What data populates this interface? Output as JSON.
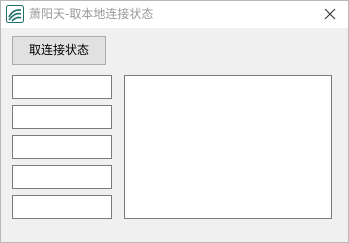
{
  "window": {
    "title": "萧阳天-取本地连接状态",
    "icon": "app-logo-icon",
    "close_icon": "close-icon"
  },
  "toolbar": {
    "action_label": "取连接状态"
  },
  "fields": [
    {
      "value": ""
    },
    {
      "value": ""
    },
    {
      "value": ""
    },
    {
      "value": ""
    },
    {
      "value": ""
    }
  ],
  "output": {
    "value": ""
  },
  "colors": {
    "window_bg": "#f0f0f0",
    "title_text": "#999999",
    "button_bg": "#e1e1e1",
    "icon_accent": "#1f6f6a"
  }
}
